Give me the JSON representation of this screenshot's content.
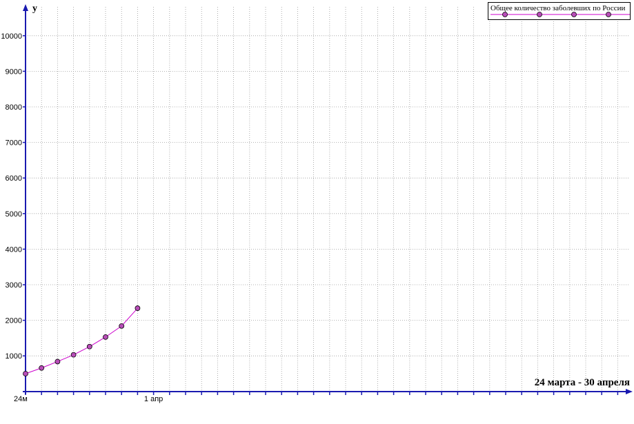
{
  "chart_data": {
    "type": "line",
    "y_axis_label": "y",
    "x_range_label": "24 марта - 30 апреля",
    "x_tick_labels": [
      {
        "day": 0,
        "text": "24м"
      },
      {
        "day": 8,
        "text": "1 апр"
      }
    ],
    "x_days_total": 38,
    "ylim": [
      500,
      10500
    ],
    "y_ticks": [
      1000,
      2000,
      3000,
      4000,
      5000,
      6000,
      7000,
      8000,
      9000,
      10000
    ],
    "grid": true,
    "legend_position": "top-right",
    "series": [
      {
        "name": "Общее количество заболевших по России",
        "color": "#cc00cc",
        "marker_color": "#b84db8",
        "x": [
          "24 марта",
          "25 марта",
          "26 марта",
          "27 марта",
          "28 марта",
          "29 марта",
          "30 марта",
          "31 марта"
        ],
        "y": [
          500,
          660,
          840,
          1030,
          1260,
          1530,
          1840,
          2340
        ]
      }
    ]
  }
}
